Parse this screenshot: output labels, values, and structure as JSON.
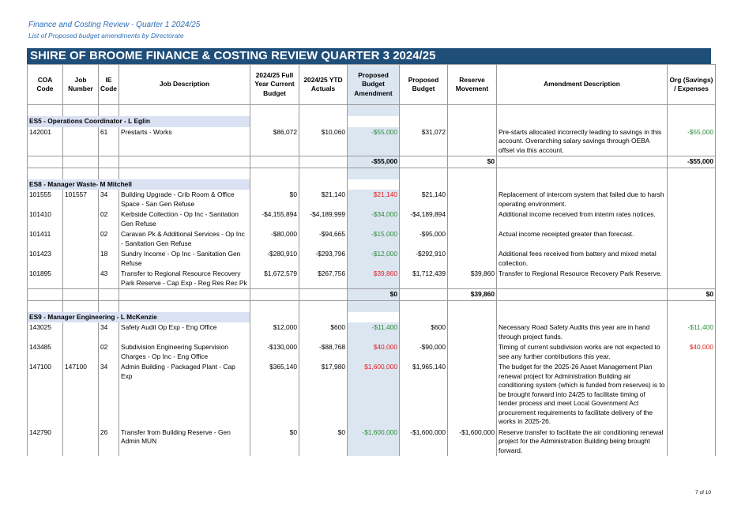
{
  "doc": {
    "title": "Finance and Costing Review - Quarter 1 2024/25",
    "subtitle": "List of Proposed budget amendments by Directorate",
    "banner": "SHIRE OF BROOME FINANCE & COSTING REVIEW QUARTER 3  2024/25",
    "page": "7 of 10"
  },
  "columns": {
    "coa": "COA Code",
    "job": "Job Number",
    "ie": "IE Code",
    "desc": "Job Description",
    "budget": "2024/25 Full Year Current Budget",
    "ytd": "2024/25 YTD Actuals",
    "amend": "Proposed Budget Amendment",
    "proposed": "Proposed Budget",
    "reserve": "Reserve Movement",
    "amdesc": "Amendment Description",
    "org": "Org (Savings) / Expenses"
  },
  "sections": [
    {
      "title": "ES5 - Operations Coordinator - L Eglin",
      "rows": [
        {
          "coa": "142001",
          "job": "",
          "ie": "61",
          "desc": "Prestarts - Works",
          "budget": "$86,072",
          "ytd": "$10,060",
          "amend": "-$55,000",
          "amend_color": "green",
          "proposed": "$31,072",
          "reserve": "",
          "amdesc": "Pre-starts allocated incorrectly leading to savings in this account. Overarching salary savings through OEBA offset via this account.",
          "org": "-$55,000",
          "org_color": "green"
        }
      ],
      "totals": {
        "amend": "-$55,000",
        "reserve": "$0",
        "org": "-$55,000"
      }
    },
    {
      "title": "ES8 - Manager Waste- M Mitchell",
      "rows": [
        {
          "coa": "101555",
          "job": "101557",
          "ie": "34",
          "desc": "Building Upgrade - Crib Room & Office Space - San Gen Refuse",
          "budget": "$0",
          "ytd": "$21,140",
          "amend": "$21,140",
          "amend_color": "red",
          "proposed": "$21,140",
          "reserve": "",
          "amdesc": "Replacement of intercom system that failed due to harsh operating environment.",
          "org": "",
          "org_color": ""
        },
        {
          "coa": "101410",
          "job": "",
          "ie": "02",
          "desc": "Kerbside Collection - Op Inc - Sanitation Gen Refuse",
          "budget": "-$4,155,894",
          "ytd": "-$4,189,999",
          "amend": "-$34,000",
          "amend_color": "green",
          "proposed": "-$4,189,894",
          "reserve": "",
          "amdesc": "Additional income received from interim rates notices.",
          "org": "",
          "org_color": ""
        },
        {
          "coa": "101411",
          "job": "",
          "ie": "02",
          "desc": "Caravan Pk & Additional Services - Op Inc - Sanitation Gen Refuse",
          "budget": "-$80,000",
          "ytd": "-$94,665",
          "amend": "-$15,000",
          "amend_color": "green",
          "proposed": "-$95,000",
          "reserve": "",
          "amdesc": "Actual income receipted greater than forecast.",
          "org": "",
          "org_color": ""
        },
        {
          "coa": "101423",
          "job": "",
          "ie": "18",
          "desc": "Sundry Income - Op Inc - Sanitation Gen Refuse",
          "budget": "-$280,910",
          "ytd": "-$293,796",
          "amend": "-$12,000",
          "amend_color": "green",
          "proposed": "-$292,910",
          "reserve": "",
          "amdesc": "Additional fees received from battery and mixed metal collection.",
          "org": "",
          "org_color": ""
        },
        {
          "coa": "101895",
          "job": "",
          "ie": "43",
          "desc": "Transfer to Regional Resource Recovery Park Reserve - Cap Exp - Reg Res Rec Pk",
          "budget": "$1,672,579",
          "ytd": "$267,756",
          "amend": "$39,860",
          "amend_color": "red",
          "proposed": "$1,712,439",
          "reserve": "$39,860",
          "amdesc": "Transfer to Regional Resource Recovery Park Reserve.",
          "org": "",
          "org_color": ""
        }
      ],
      "totals": {
        "amend": "$0",
        "reserve": "$39,860",
        "org": "$0"
      }
    },
    {
      "title": "ES9 - Manager Engineering -  L McKenzie",
      "rows": [
        {
          "coa": "143025",
          "job": "",
          "ie": "34",
          "desc": "Safety Audit Op Exp - Eng Office",
          "budget": "$12,000",
          "ytd": "$600",
          "amend": "-$11,400",
          "amend_color": "green",
          "proposed": "$600",
          "reserve": "",
          "amdesc": "Necessary Road Safety Audits this year are in hand through project funds.",
          "org": "-$11,400",
          "org_color": "green"
        },
        {
          "coa": "143485",
          "job": "",
          "ie": "02",
          "desc": "Subdivision Engineering Supervision Charges - Op Inc - Eng Office",
          "budget": "-$130,000",
          "ytd": "-$88,768",
          "amend": "$40,000",
          "amend_color": "red",
          "proposed": "-$90,000",
          "reserve": "",
          "amdesc": "Timing of current subdivision works are not expected to see any further contributions this year.",
          "org": "$40,000",
          "org_color": "red"
        },
        {
          "coa": "147100",
          "job": "147100",
          "ie": "34",
          "desc": "Admin Building - Packaged Plant - Cap Exp",
          "budget": "$365,140",
          "ytd": "$17,980",
          "amend": "$1,600,000",
          "amend_color": "red",
          "proposed": "$1,965,140",
          "reserve": "",
          "amdesc": "The budget for the 2025-26 Asset Management Plan renewal project for Administration Building air conditioning system (which is funded from reserves) is to be brought forward into 24/25 to facilitate timing of tender process and meet Local Government Act procurement requirements to facilitate delivery of the works in 2025-26.",
          "org": "",
          "org_color": ""
        },
        {
          "coa": "142790",
          "job": "",
          "ie": "26",
          "desc": "Transfer from Building Reserve - Gen Admin MUN",
          "budget": "$0",
          "ytd": "$0",
          "amend": "-$1,600,000",
          "amend_color": "green",
          "proposed": "-$1,600,000",
          "reserve": "-$1,600,000",
          "amdesc": "Reserve transfer to facilitate the air conditioning renewal project for the Administration Building being brought forward.",
          "org": "",
          "org_color": ""
        }
      ]
    }
  ]
}
